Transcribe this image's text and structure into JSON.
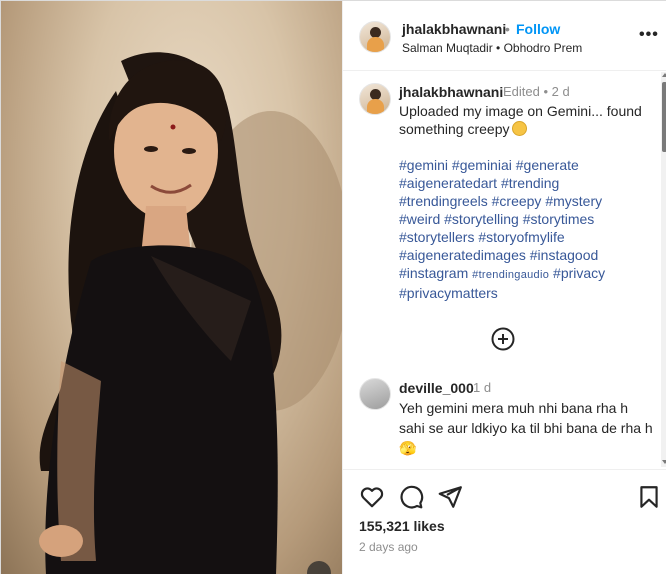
{
  "post": {
    "author": "jhalakbhawnani",
    "follow_label": "Follow",
    "separator": "•",
    "audio": "Salman Muqtadir • Obhodro Prem",
    "more_label": "•••",
    "photo_description": "Woman in black saree"
  },
  "caption": {
    "username": "jhalakbhawnani",
    "meta": "Edited • 2 d",
    "text": "Uploaded my image on Gemini... found something creepy",
    "emoji": "grimacing-face-emoji",
    "hashtags": [
      "#gemini",
      "#geminiai",
      "#generate",
      "#aigeneratedart",
      "#trending",
      "#trendingreels",
      "#creepy",
      "#mystery",
      "#weird",
      "#storytelling",
      "#storytimes",
      "#storytellers",
      "#storyofmylife",
      "#aigeneratedimages",
      "#instagood",
      "#instagram",
      "#trendingaudio",
      "#privacy",
      "#privacymatters"
    ]
  },
  "comment": {
    "username": "deville_000",
    "time": "1 d",
    "text": "Yeh gemini mera muh nhi bana rha h sahi se aur ldkiyo ka til bhi bana de rha h 🫣"
  },
  "actions": {
    "likes": "155,321 likes",
    "date": "2 days ago",
    "icons": [
      "heart-icon",
      "comment-icon",
      "share-icon",
      "bookmark-icon"
    ]
  },
  "colors": {
    "link_blue": "#0095f6",
    "hashtag_blue": "#385898",
    "muted_gray": "#8e8e8e",
    "text_dark": "#262626"
  }
}
